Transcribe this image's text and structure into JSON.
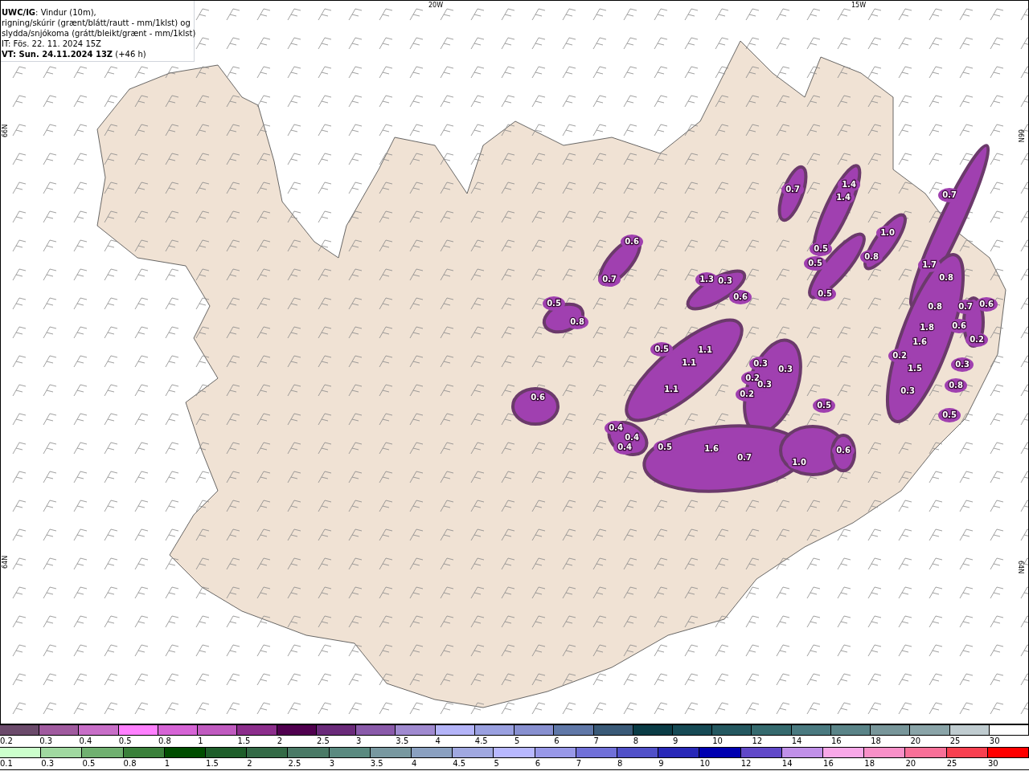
{
  "header": {
    "lines": [
      "**UWC/IG**: Vindur (10m),",
      "rigning/skúrir (grænt/blátt/rautt - mm/1klst) og",
      "slydda/snjókoma (grátt/bleikt/grænt - mm/1klst)",
      "IT: Fös. 22. 11. 2024 15Z",
      "**VT: Sun. 24.11.2024 13Z** (+46 h)"
    ]
  },
  "map": {
    "top_labels": [
      "20W",
      "15W"
    ],
    "left_labels": [
      "66N",
      "64N"
    ],
    "right_labels": [
      "66N",
      "64N"
    ],
    "precip_labels": [
      "0.7",
      "1.4",
      "1.4",
      "0.7",
      "1.0",
      "0.5",
      "0.5",
      "0.8",
      "1.7",
      "0.8",
      "0.6",
      "0.7",
      "1.3",
      "0.3",
      "0.6",
      "0.5",
      "0.5",
      "0.8",
      "0.8",
      "0.7",
      "0.6",
      "1.8",
      "0.6",
      "0.5",
      "1.1",
      "1.6",
      "0.2",
      "1.1",
      "0.3",
      "0.2",
      "0.2",
      "1.5",
      "0.3",
      "0.3",
      "1.1",
      "0.3",
      "0.2",
      "0.3",
      "0.8",
      "0.6",
      "0.5",
      "0.5",
      "0.4",
      "0.4",
      "0.4",
      "0.5",
      "1.6",
      "0.7",
      "1.0",
      "0.6"
    ]
  },
  "legends": [
    {
      "kind": "upper",
      "items": [
        {
          "color": "#6b4a6b",
          "label": "0.2"
        },
        {
          "color": "#a05a9f",
          "label": "0.3"
        },
        {
          "color": "#c86ec8",
          "label": "0.4"
        },
        {
          "color": "#ff80ff",
          "label": "0.5"
        },
        {
          "color": "#d664d6",
          "label": "0.8"
        },
        {
          "color": "#c05ac0",
          "label": "1"
        },
        {
          "color": "#8c2d8c",
          "label": "1.5"
        },
        {
          "color": "#50004f",
          "label": "2"
        },
        {
          "color": "#6a2a7a",
          "label": "2.5"
        },
        {
          "color": "#8a5aaa",
          "label": "3"
        },
        {
          "color": "#a08ad0",
          "label": "3.5"
        },
        {
          "color": "#b4b4f8",
          "label": "4"
        },
        {
          "color": "#9aa0e0",
          "label": "4.5"
        },
        {
          "color": "#8890d0",
          "label": "5"
        },
        {
          "color": "#6078a8",
          "label": "6"
        },
        {
          "color": "#3a5a78",
          "label": "7"
        },
        {
          "color": "#0a3c46",
          "label": "8"
        },
        {
          "color": "#164a55",
          "label": "9"
        },
        {
          "color": "#245860",
          "label": "10"
        },
        {
          "color": "#356a6e",
          "label": "12"
        },
        {
          "color": "#4a7a80",
          "label": "14"
        },
        {
          "color": "#5a8488",
          "label": "16"
        },
        {
          "color": "#78969a",
          "label": "18"
        },
        {
          "color": "#8aa4a8",
          "label": "20"
        },
        {
          "color": "#c0ccd0",
          "label": "25"
        },
        {
          "color": "#ffffff",
          "label": "30"
        }
      ]
    },
    {
      "kind": "lower",
      "items": [
        {
          "color": "#ccffcc",
          "label": "0.1"
        },
        {
          "color": "#a0d8a0",
          "label": "0.3"
        },
        {
          "color": "#70b070",
          "label": "0.5"
        },
        {
          "color": "#3a803a",
          "label": "0.8"
        },
        {
          "color": "#004d00",
          "label": "1"
        },
        {
          "color": "#1e5e2a",
          "label": "1.5"
        },
        {
          "color": "#336a46",
          "label": "2"
        },
        {
          "color": "#4a7a66",
          "label": "2.5"
        },
        {
          "color": "#5a8a80",
          "label": "3"
        },
        {
          "color": "#7898a0",
          "label": "3.5"
        },
        {
          "color": "#8aa0c0",
          "label": "4"
        },
        {
          "color": "#a0a8e0",
          "label": "4.5"
        },
        {
          "color": "#b8b8ff",
          "label": "5"
        },
        {
          "color": "#9898e8",
          "label": "6"
        },
        {
          "color": "#7070d8",
          "label": "7"
        },
        {
          "color": "#5050c8",
          "label": "8"
        },
        {
          "color": "#2828b8",
          "label": "9"
        },
        {
          "color": "#0000b0",
          "label": "10"
        },
        {
          "color": "#6048c8",
          "label": "12"
        },
        {
          "color": "#c090e8",
          "label": "14"
        },
        {
          "color": "#f8a8e8",
          "label": "16"
        },
        {
          "color": "#f890c8",
          "label": "18"
        },
        {
          "color": "#f87098",
          "label": "20"
        },
        {
          "color": "#f84050",
          "label": "25"
        },
        {
          "color": "#ff0000",
          "label": "30"
        }
      ]
    }
  ]
}
